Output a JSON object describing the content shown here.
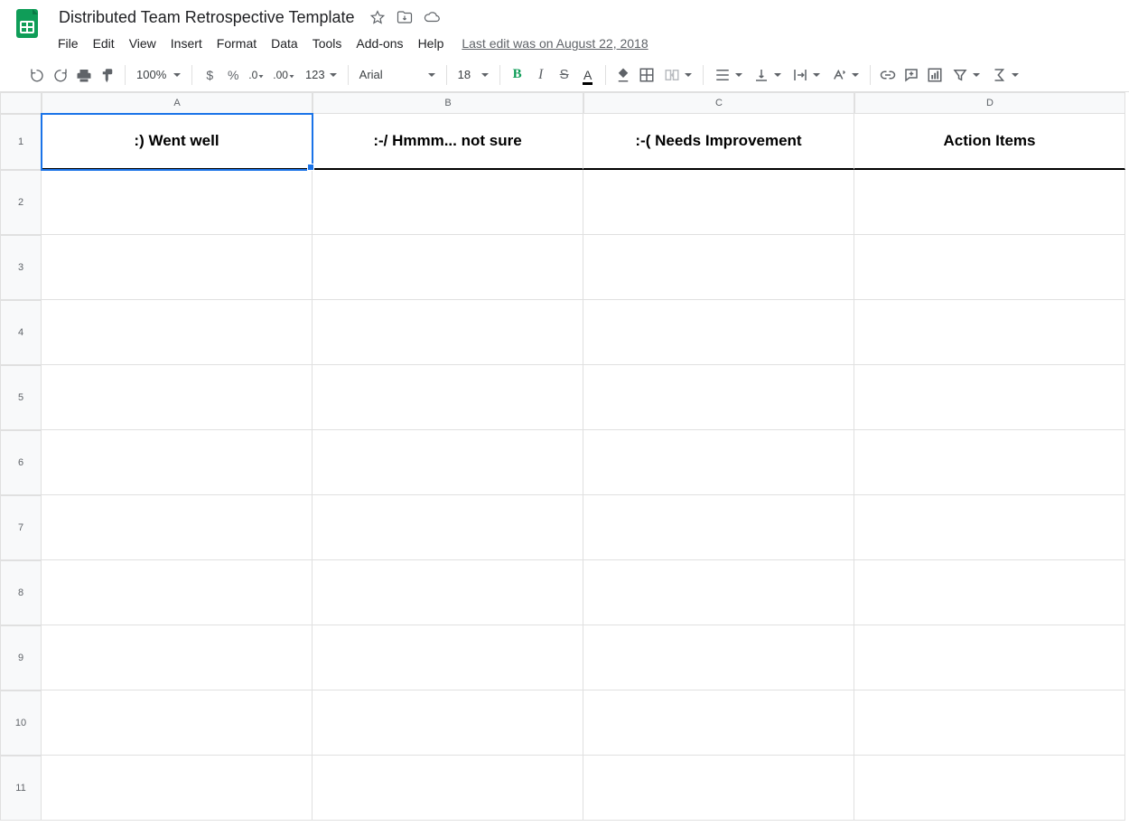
{
  "doc": {
    "title": "Distributed Team Retrospective Template",
    "last_edit": "Last edit was on August 22, 2018"
  },
  "menu": {
    "file": "File",
    "edit": "Edit",
    "view": "View",
    "insert": "Insert",
    "format": "Format",
    "data": "Data",
    "tools": "Tools",
    "addons": "Add-ons",
    "help": "Help"
  },
  "toolbar": {
    "zoom": "100%",
    "currency": "$",
    "percent": "%",
    "dec_dec": ".0",
    "inc_dec": ".00",
    "num_fmt": "123",
    "font": "Arial",
    "font_size": "18",
    "bold": "B",
    "italic": "I",
    "strike": "S",
    "text_color": "A"
  },
  "columns": [
    "A",
    "B",
    "C",
    "D"
  ],
  "rows": [
    "1",
    "2",
    "3",
    "4",
    "5",
    "6",
    "7",
    "8",
    "9",
    "10",
    "11"
  ],
  "headers": {
    "A": ":) Went well",
    "B": ":-/ Hmmm... not sure",
    "C": ":-( Needs Improvement",
    "D": "Action Items"
  }
}
